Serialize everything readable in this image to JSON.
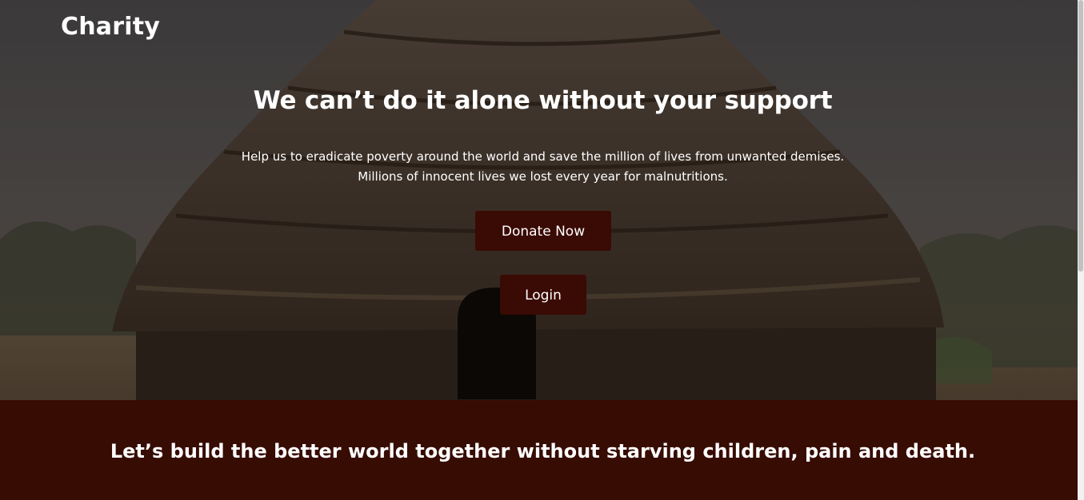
{
  "header": {
    "brand": "Charity"
  },
  "hero": {
    "headline": "We can’t do it alone without your support",
    "subtext_line1": "Help us to eradicate poverty around the world and save the million of lives from unwanted demises.",
    "subtext_line2": "Millions of innocent lives we lost every year for malnutritions.",
    "donate_label": "Donate Now",
    "login_label": "Login"
  },
  "band": {
    "title": "Let’s build the better world together without starving children, pain and death."
  },
  "colors": {
    "accent": "#3a0a04",
    "band": "#370c03"
  }
}
